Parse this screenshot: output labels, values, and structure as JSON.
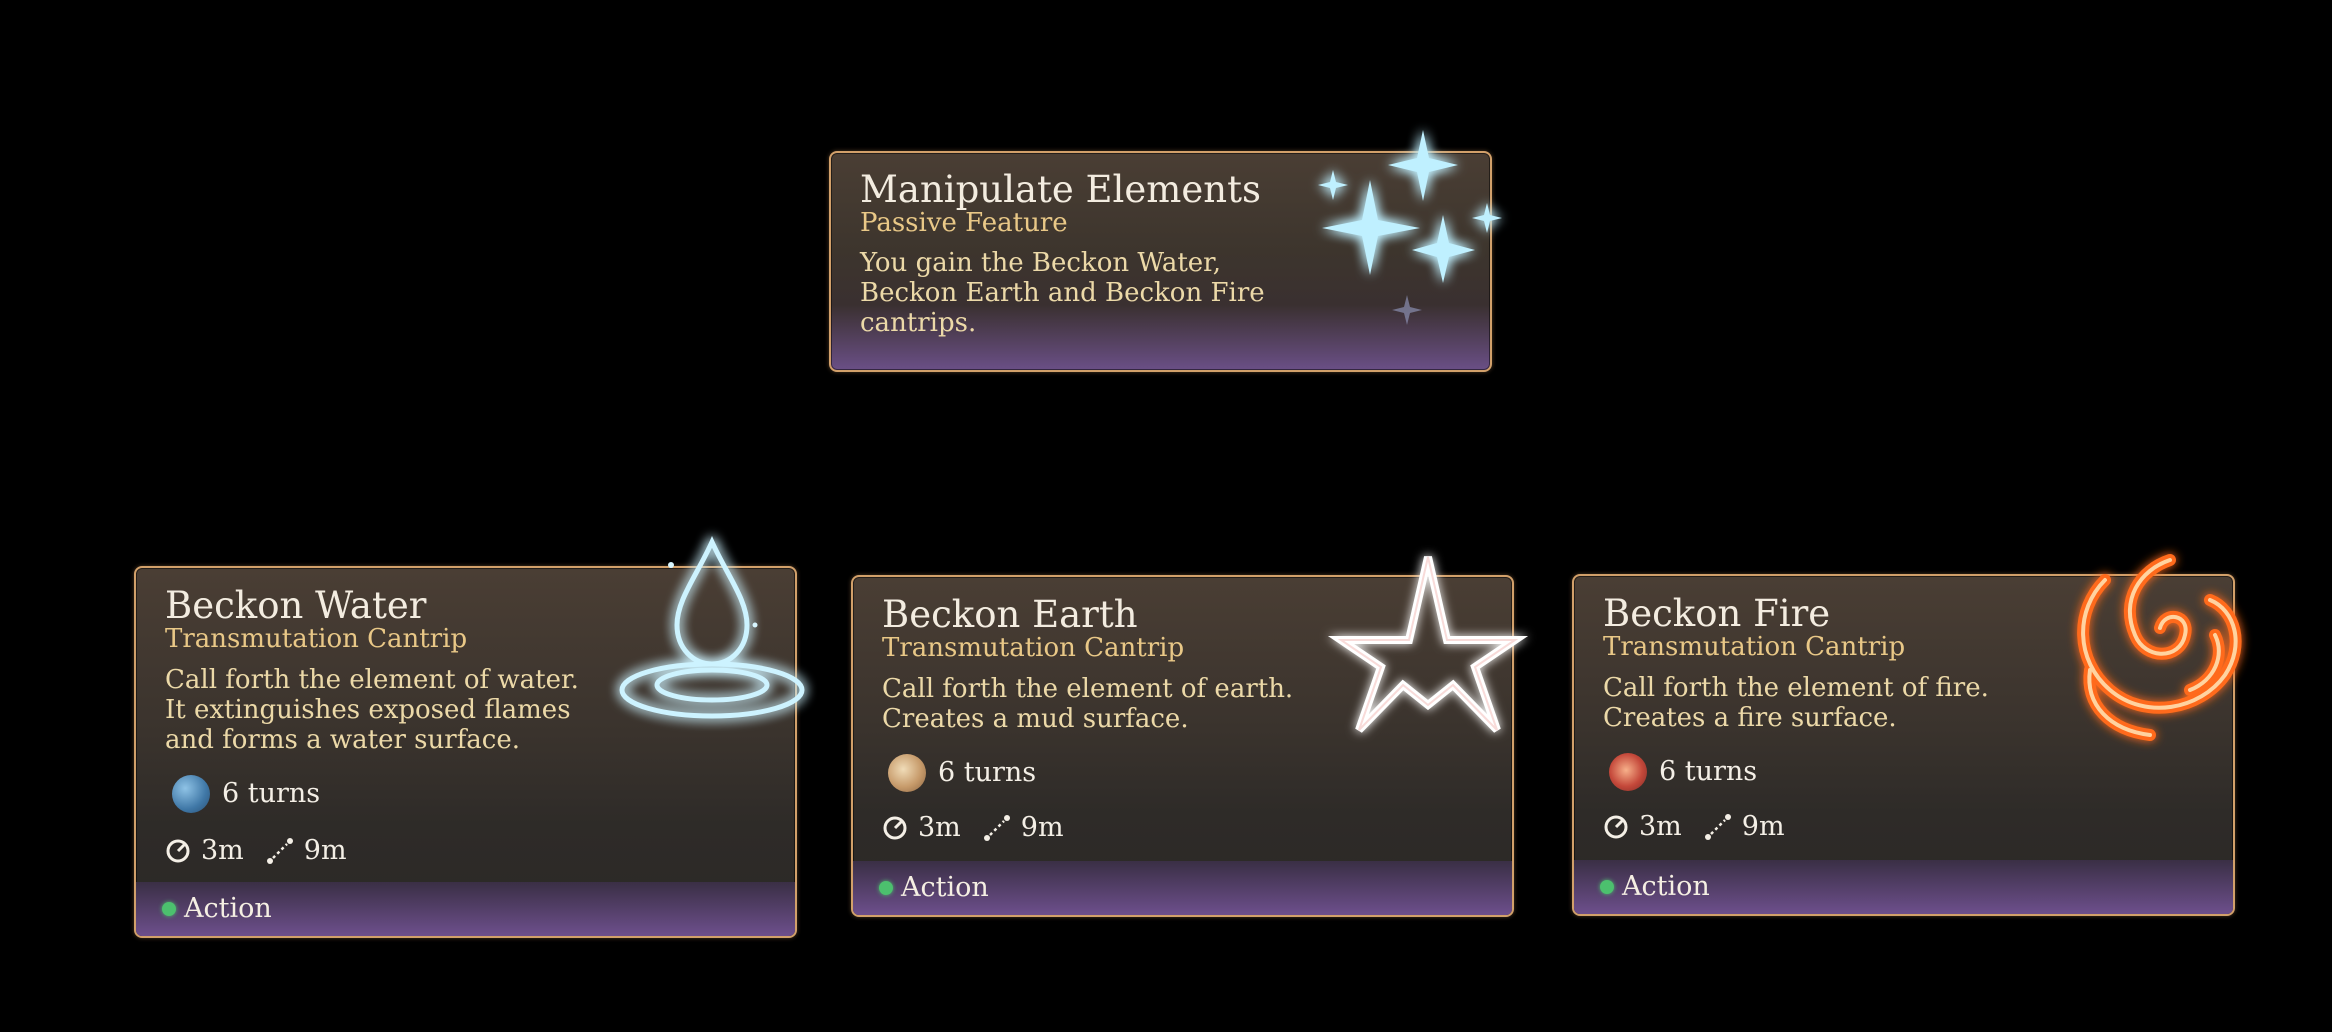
{
  "passive": {
    "title": "Manipulate Elements",
    "subtitle": "Passive Feature",
    "description": [
      "You gain the Beckon Water,",
      "Beckon Earth and Beckon Fire",
      "cantrips."
    ],
    "icon": "sparkles-icon"
  },
  "spells": [
    {
      "title": "Beckon Water",
      "subtitle": "Transmutation Cantrip",
      "description": [
        "Call forth the element of water.",
        "It extinguishes exposed flames",
        "and forms a water surface."
      ],
      "duration": "6 turns",
      "radius": "3m",
      "range": "9m",
      "cost": "Action",
      "icon": "water-drop-icon",
      "surface_icon": "water-surface-icon",
      "accent": "#7fd8ff"
    },
    {
      "title": "Beckon Earth",
      "subtitle": "Transmutation Cantrip",
      "description": [
        "Call forth the element of earth.",
        "Creates a mud surface."
      ],
      "duration": "6 turns",
      "radius": "3m",
      "range": "9m",
      "cost": "Action",
      "icon": "earth-peak-icon",
      "surface_icon": "mud-surface-icon",
      "accent": "#ffffff"
    },
    {
      "title": "Beckon Fire",
      "subtitle": "Transmutation Cantrip",
      "description": [
        "Call forth the element of fire.",
        "Creates a fire surface."
      ],
      "duration": "6 turns",
      "radius": "3m",
      "range": "9m",
      "cost": "Action",
      "icon": "flame-icon",
      "surface_icon": "fire-surface-icon",
      "accent": "#ff7a2a"
    }
  ],
  "colors": {
    "border": "#d2a06a",
    "title": "#f3ece0",
    "subtitle": "#e9c887",
    "description": "#ecd9a8",
    "action_dot": "#4cc06e"
  }
}
